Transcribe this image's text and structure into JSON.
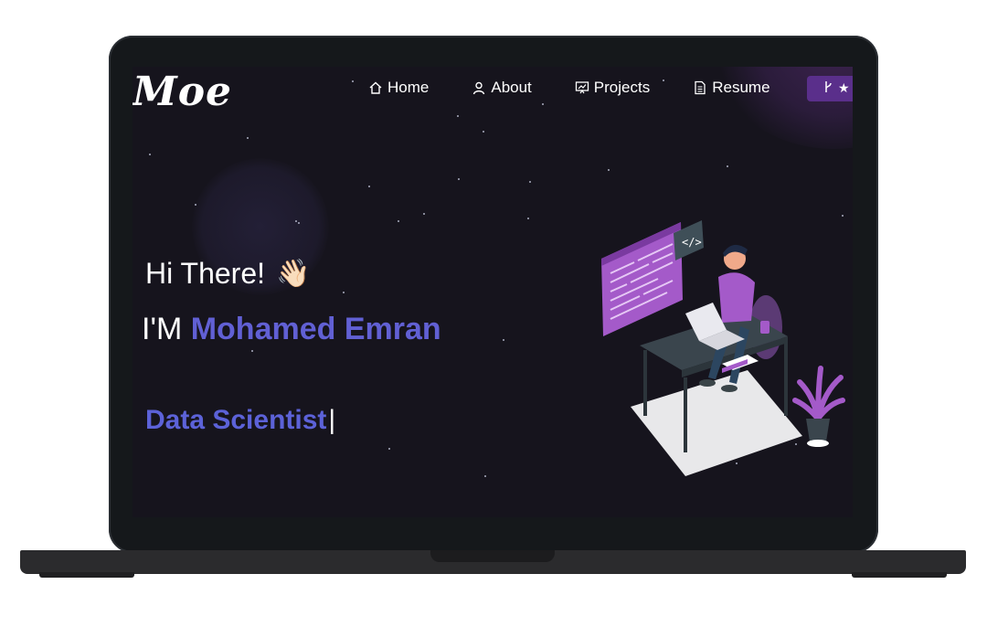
{
  "brand": {
    "logo_text": "Moe"
  },
  "nav": {
    "items": [
      {
        "label": "Home",
        "icon": "home-icon"
      },
      {
        "label": "About",
        "icon": "user-icon"
      },
      {
        "label": "Projects",
        "icon": "projects-icon"
      },
      {
        "label": "Resume",
        "icon": "document-icon"
      }
    ],
    "github_button": {
      "icons": [
        "fork-icon",
        "star-icon"
      ]
    }
  },
  "hero": {
    "greeting": "Hi There!",
    "wave_emoji": "👋🏻",
    "intro_prefix": "I'M",
    "name": "Mohamed Emran",
    "role": "Data Scientist",
    "cursor": "|"
  },
  "illustration": {
    "code_tag": "</>"
  },
  "colors": {
    "accent_name": "#6160d4",
    "accent_role": "#5c62d8",
    "background": "#16141d",
    "button": "#5a2f8b",
    "illustration_purple": "#a45ac9"
  }
}
